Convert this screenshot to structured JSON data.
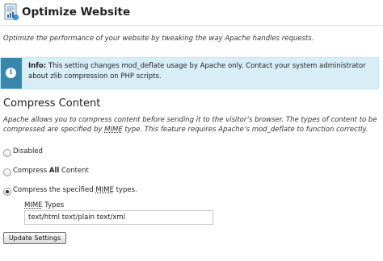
{
  "header": {
    "title": "Optimize Website",
    "icon": "document-chart-icon"
  },
  "intro": "Optimize the performance of your website by tweaking the way Apache handles requests.",
  "info": {
    "label": "Info:",
    "line1": " This setting changes mod_deflate usage by Apache only. Contact your system administrator",
    "line2": "about zlib compression on PHP scripts.",
    "accent": "#3a87ad",
    "background": "#d9edf7"
  },
  "compress": {
    "heading": "Compress Content",
    "desc_part1": "Apache allows you to compress content before sending it to the visitor’s browser. The types of content to be compressed are specified by ",
    "desc_abbr": "MIME",
    "desc_part2": " type. This feature requires Apache’s mod_deflate to function correctly.",
    "options": {
      "disabled": "Disabled",
      "all_prefix": "Compress ",
      "all_bold": "All",
      "all_suffix": " Content",
      "specified_prefix": "Compress the specified ",
      "specified_abbr": "MIME",
      "specified_suffix": " types.",
      "selected": "specified"
    },
    "mime_label_abbr": "MIME",
    "mime_label_suffix": " Types",
    "mime_value": "text/html text/plain text/xml"
  },
  "actions": {
    "update_label": "Update Settings"
  }
}
